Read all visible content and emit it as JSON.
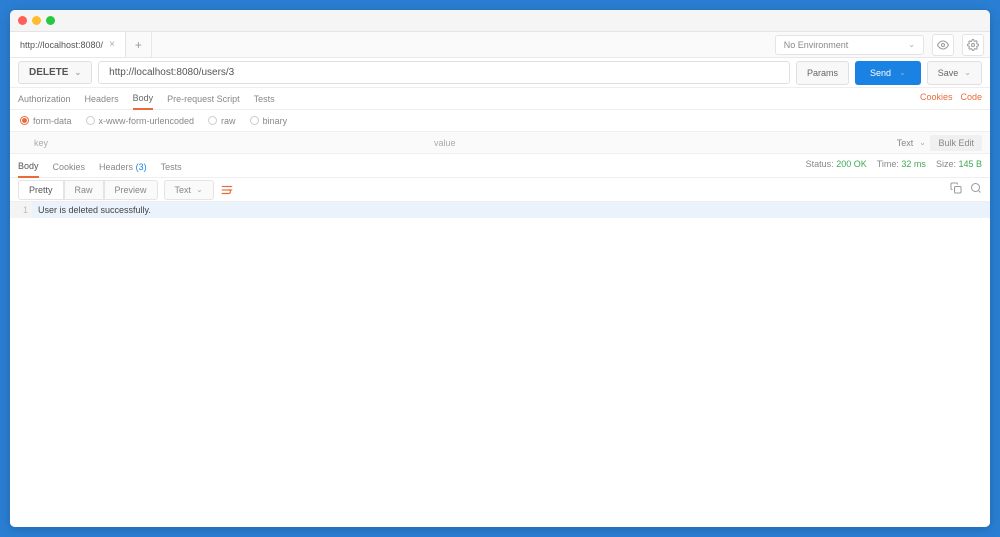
{
  "window": {
    "tab_title": "http://localhost:8080/",
    "env_placeholder": "No Environment"
  },
  "request": {
    "method": "DELETE",
    "url": "http://localhost:8080/users/3",
    "params_btn": "Params",
    "send_btn": "Send",
    "save_btn": "Save"
  },
  "reqtabs": {
    "auth": "Authorization",
    "headers": "Headers",
    "body": "Body",
    "prs": "Pre-request Script",
    "tests": "Tests",
    "cookies_link": "Cookies",
    "code_link": "Code"
  },
  "bodymode": {
    "formdata": "form-data",
    "urlenc": "x-www-form-urlencoded",
    "raw": "raw",
    "binary": "binary"
  },
  "kv": {
    "key": "key",
    "value": "value",
    "type_sel": "Text",
    "bulk": "Bulk Edit"
  },
  "resptabs": {
    "body": "Body",
    "cookies": "Cookies",
    "headers": "Headers",
    "headers_n": "(3)",
    "tests": "Tests"
  },
  "status": {
    "status_lbl": "Status:",
    "status_val": "200 OK",
    "time_lbl": "Time:",
    "time_val": "32 ms",
    "size_lbl": "Size:",
    "size_val": "145 B"
  },
  "view": {
    "pretty": "Pretty",
    "raw": "Raw",
    "preview": "Preview",
    "format": "Text"
  },
  "response": {
    "line_no": "1",
    "text": "User is deleted successfully."
  }
}
